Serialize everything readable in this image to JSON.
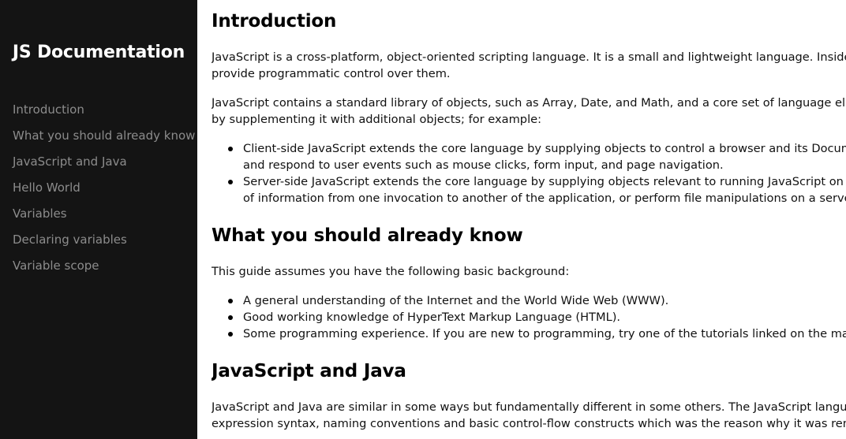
{
  "navbar": {
    "title": "JS Documentation",
    "links": [
      "Introduction",
      "What you should already know",
      "JavaScript and Java",
      "Hello World",
      "Variables",
      "Declaring variables",
      "Variable scope"
    ]
  },
  "sections": {
    "introduction": {
      "heading": "Introduction",
      "p1": [
        "JavaScript is a cross-platform, object-oriented scripting language. It is a small and lightweight language. Inside a h",
        "provide programmatic control over them."
      ],
      "p2": [
        "JavaScript contains a standard library of objects, such as Array, Date, and Math, and a core set of language elemen",
        "by supplementing it with additional objects; for example:"
      ],
      "items": [
        [
          "Client-side JavaScript extends the core language by supplying objects to control a browser and its Document",
          "and respond to user events such as mouse clicks, form input, and page navigation."
        ],
        [
          "Server-side JavaScript extends the core language by supplying objects relevant to running JavaScript on a se",
          "of information from one invocation to another of the application, or perform file manipulations on a server."
        ]
      ]
    },
    "already_know": {
      "heading": "What you should already know",
      "p1": "This guide assumes you have the following basic background:",
      "items": [
        "A general understanding of the Internet and the World Wide Web (WWW).",
        "Good working knowledge of HyperText Markup Language (HTML).",
        "Some programming experience. If you are new to programming, try one of the tutorials linked on the main p"
      ]
    },
    "js_and_java": {
      "heading": "JavaScript and Java",
      "p1": [
        "JavaScript and Java are similar in some ways but fundamentally different in some others. The JavaScript language r",
        "expression syntax, naming conventions and basic control-flow constructs which was the reason why it was rename"
      ]
    }
  }
}
